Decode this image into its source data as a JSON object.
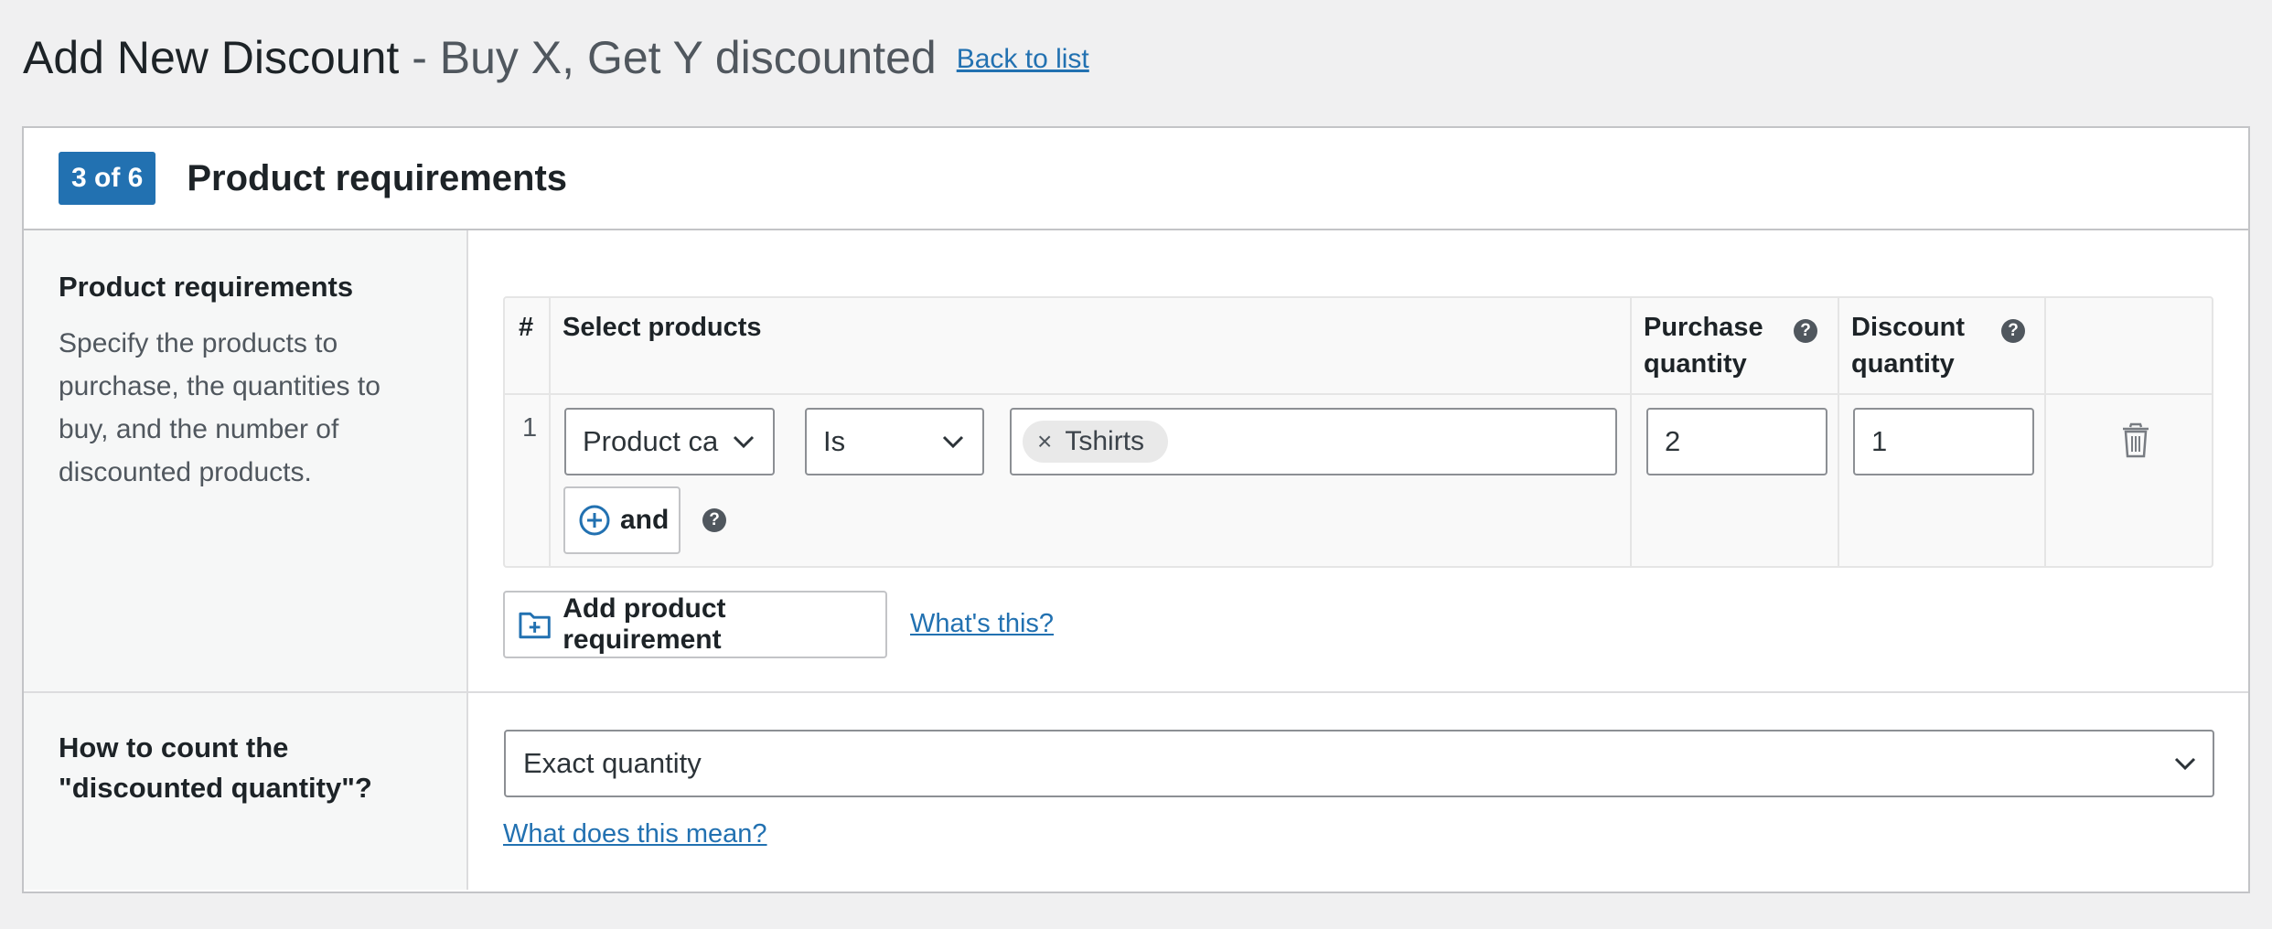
{
  "header": {
    "title": "Add New Discount",
    "subtitle": "- Buy X, Get Y discounted",
    "back_link": "Back to list"
  },
  "panel": {
    "step_badge": "3 of 6",
    "title": "Product requirements"
  },
  "product_requirements": {
    "label_title": "Product requirements",
    "label_desc": "Specify the products to purchase, the quantities to buy, and the number of discounted products.",
    "table": {
      "columns": {
        "num": "#",
        "select_products": "Select products",
        "purchase_quantity": "Purchase quantity",
        "discount_quantity": "Discount quantity"
      },
      "rows": [
        {
          "num": "1",
          "condition_type": "Product ca",
          "operator": "Is",
          "tokens": [
            "Tshirts"
          ],
          "purchase_quantity": "2",
          "discount_quantity": "1",
          "and_button": "and"
        }
      ]
    },
    "add_button": "Add product requirement",
    "whats_this": "What's this?"
  },
  "count_method": {
    "label_title": "How to count the \"discounted quantity\"?",
    "selected": "Exact quantity",
    "help_link": "What does this mean?"
  },
  "icons": {
    "help": "?",
    "remove_token": "×"
  },
  "colors": {
    "accent": "#2271b1",
    "background": "#f0f0f1"
  }
}
